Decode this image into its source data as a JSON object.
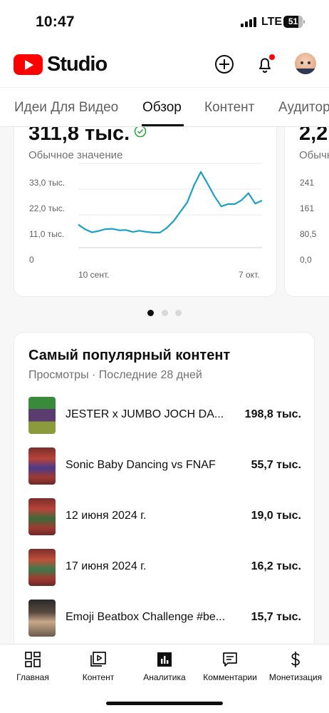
{
  "status_bar": {
    "time": "10:47",
    "network": "LTE",
    "battery": "51"
  },
  "app": {
    "title": "Studio",
    "create_icon": "plus-circle-icon",
    "notifications_icon": "bell-icon"
  },
  "tabs": [
    {
      "label": "Идеи Для Видео",
      "active": false
    },
    {
      "label": "Обзор",
      "active": true
    },
    {
      "label": "Контент",
      "active": false
    },
    {
      "label": "Аудитор",
      "active": false
    }
  ],
  "metric_card": {
    "value": "311,8 тыс.",
    "subtitle": "Обычное значение",
    "y_ticks": [
      "33,0 тыс.",
      "22,0 тыс.",
      "11,0 тыс.",
      "0"
    ],
    "x_ticks": [
      "10 сент.",
      "7 окт."
    ],
    "line_color": "#1ba1c7"
  },
  "metric_card_2": {
    "value": "2,2",
    "subtitle": "Обычн",
    "y_ticks": [
      "241",
      "161",
      "80,5",
      "0,0"
    ]
  },
  "chart_data": {
    "type": "line",
    "x": [
      "10 сент.",
      "",
      "",
      "",
      "",
      "",
      "",
      "",
      "",
      "",
      "",
      "",
      "",
      "",
      "",
      "",
      "",
      "",
      "",
      "",
      "",
      "",
      "",
      "",
      "",
      "",
      "",
      "7 окт."
    ],
    "series": [
      {
        "values": [
          6800,
          4800,
          3500,
          4100,
          4900,
          5000,
          4400,
          4500,
          3700,
          4200,
          3700,
          3400,
          3400,
          5400,
          8300,
          12300,
          16300,
          23600,
          29400,
          24300,
          19000,
          14600,
          15600,
          15600,
          17300,
          20300,
          15800,
          17100
        ]
      }
    ],
    "ylim": [
      0,
      33000
    ],
    "y_ticks": [
      "33,0 тыс.",
      "22,0 тыс.",
      "11,0 тыс.",
      "0"
    ],
    "grid": true
  },
  "carousel": {
    "pages": 3,
    "active": 0
  },
  "top_content": {
    "title": "Самый популярный контент",
    "subtitle": "Просмотры · Последние 28 дней",
    "rows": [
      {
        "title": "JESTER x JUMBO JOCH DA...",
        "views": "198,8 тыс."
      },
      {
        "title": "Sonic Baby Dancing vs FNAF",
        "views": "55,7 тыс."
      },
      {
        "title": "12 июня 2024 г.",
        "views": "19,0 тыс."
      },
      {
        "title": "17 июня 2024 г.",
        "views": "16,2 тыс."
      },
      {
        "title": "Emoji Beatbox Challenge #be...",
        "views": "15,7 тыс."
      }
    ]
  },
  "bottom_nav": [
    {
      "label": "Главная",
      "icon": "dashboard-icon",
      "active": false
    },
    {
      "label": "Контент",
      "icon": "video-library-icon",
      "active": false
    },
    {
      "label": "Аналитика",
      "icon": "analytics-icon",
      "active": true
    },
    {
      "label": "Комментарии",
      "icon": "comments-icon",
      "active": false
    },
    {
      "label": "Монетизация",
      "icon": "dollar-icon",
      "active": false
    }
  ]
}
